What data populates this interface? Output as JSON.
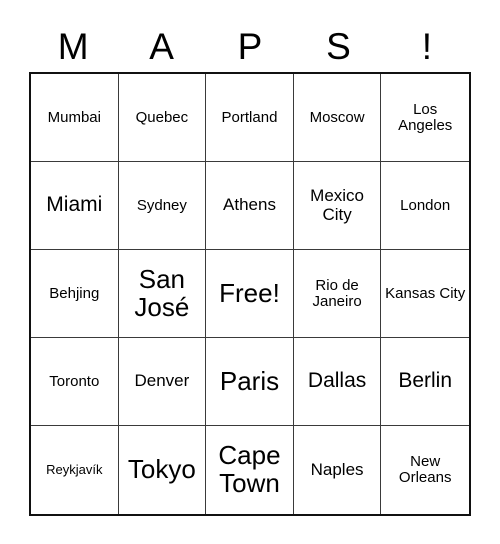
{
  "card": {
    "header_letters": [
      "M",
      "A",
      "P",
      "S",
      "!"
    ],
    "grid": {
      "columns": 5,
      "rows": 5,
      "cells": [
        {
          "label": "Mumbai",
          "size": "sm"
        },
        {
          "label": "Quebec",
          "size": "sm"
        },
        {
          "label": "Portland",
          "size": "sm"
        },
        {
          "label": "Moscow",
          "size": "sm"
        },
        {
          "label": "Los Angeles",
          "size": "sm"
        },
        {
          "label": "Miami",
          "size": "lg"
        },
        {
          "label": "Sydney",
          "size": "sm"
        },
        {
          "label": "Athens",
          "size": "md"
        },
        {
          "label": "Mexico City",
          "size": "md"
        },
        {
          "label": "London",
          "size": "sm"
        },
        {
          "label": "Behjing",
          "size": "sm"
        },
        {
          "label": "San José",
          "size": "xl"
        },
        {
          "label": "Free!",
          "size": "xl"
        },
        {
          "label": "Rio de Janeiro",
          "size": "sm"
        },
        {
          "label": "Kansas City",
          "size": "sm"
        },
        {
          "label": "Toronto",
          "size": "sm"
        },
        {
          "label": "Denver",
          "size": "md"
        },
        {
          "label": "Paris",
          "size": "xl"
        },
        {
          "label": "Dallas",
          "size": "lg"
        },
        {
          "label": "Berlin",
          "size": "lg"
        },
        {
          "label": "Reykjavík",
          "size": "xs"
        },
        {
          "label": "Tokyo",
          "size": "xl"
        },
        {
          "label": "Cape Town",
          "size": "xl"
        },
        {
          "label": "Naples",
          "size": "md"
        },
        {
          "label": "New Orleans",
          "size": "sm"
        }
      ]
    },
    "colors": {
      "background": "#ffffff",
      "text": "#000000",
      "grid_line": "#3a3a3a",
      "outer_border": "#111111"
    }
  }
}
